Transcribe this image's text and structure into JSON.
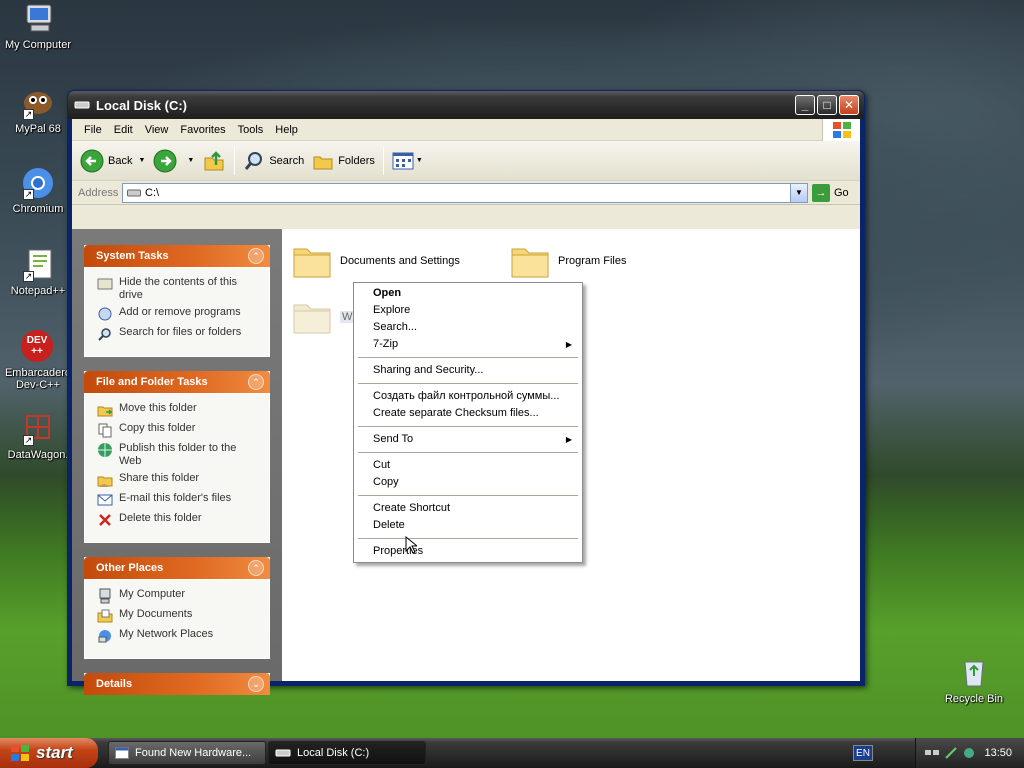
{
  "desktop": {
    "icons": [
      {
        "label": "My Computer"
      },
      {
        "label": "MyPal 68"
      },
      {
        "label": "Chromium"
      },
      {
        "label": "Notepad++"
      },
      {
        "label": "Embarcadero Dev-C++"
      },
      {
        "label": "DataWagon."
      },
      {
        "label": "Recycle Bin"
      }
    ],
    "devc_badge": "DEV",
    "devc_plus": "++"
  },
  "window": {
    "title": "Local Disk (C:)",
    "controls": {
      "minimize": "_",
      "maximize": "□",
      "close": "✕"
    },
    "menu": [
      "File",
      "Edit",
      "View",
      "Favorites",
      "Tools",
      "Help"
    ],
    "toolbar": {
      "back": "Back",
      "search": "Search",
      "folders": "Folders"
    },
    "address": {
      "label": "Address",
      "value": "C:\\",
      "go": "Go"
    },
    "taskpane": {
      "system_tasks": {
        "title": "System Tasks",
        "items": [
          "Hide the contents of this drive",
          "Add or remove programs",
          "Search for files or folders"
        ]
      },
      "file_folder_tasks": {
        "title": "File and Folder Tasks",
        "items": [
          "Move this folder",
          "Copy this folder",
          "Publish this folder to the Web",
          "Share this folder",
          "E-mail this folder's files",
          "Delete this folder"
        ]
      },
      "other_places": {
        "title": "Other Places",
        "items": [
          "My Computer",
          "My Documents",
          "My Network Places"
        ]
      },
      "details": {
        "title": "Details"
      }
    },
    "files": [
      {
        "name": "Documents and Settings"
      },
      {
        "name": "Program Files"
      },
      {
        "name": "WI"
      }
    ]
  },
  "context_menu": {
    "open": "Open",
    "explore": "Explore",
    "search": "Search...",
    "zip": "7-Zip",
    "sharing": "Sharing and Security...",
    "checksum_ru": "Создать файл контрольной суммы...",
    "checksum_separate": "Create separate Checksum files...",
    "send_to": "Send To",
    "cut": "Cut",
    "copy": "Copy",
    "create_shortcut": "Create Shortcut",
    "delete": "Delete",
    "properties": "Properties"
  },
  "taskbar": {
    "start": "start",
    "tasks": [
      {
        "label": "Found New Hardware..."
      },
      {
        "label": "Local Disk (C:)"
      }
    ],
    "lang": "EN",
    "clock": "13:50"
  }
}
